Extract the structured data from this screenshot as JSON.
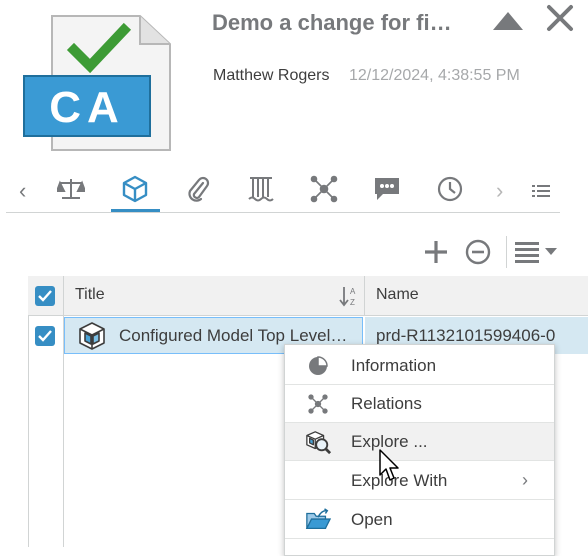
{
  "header": {
    "title": "Demo a change for fi…",
    "author": "Matthew Rogers",
    "date": "12/12/2024, 4:38:55 PM",
    "app_icon_text": "CA"
  },
  "tabs": [
    {
      "name": "scales-icon",
      "active": false
    },
    {
      "name": "cube-icon",
      "active": true
    },
    {
      "name": "paperclip-icon",
      "active": false
    },
    {
      "name": "columns-icon",
      "active": false
    },
    {
      "name": "relations-icon",
      "active": false
    },
    {
      "name": "chat-icon",
      "active": false
    },
    {
      "name": "clock-icon",
      "active": false
    }
  ],
  "tab_nav": {
    "prev": "‹",
    "next": "›"
  },
  "toolbar": {
    "icons": [
      "plus-icon",
      "minus-circle-icon",
      "list-view-icon"
    ]
  },
  "table": {
    "columns": [
      "Title",
      "Name"
    ],
    "rows": [
      {
        "title": "Configured Model Top Level…",
        "name": "prd-R1132101599406-0",
        "selected": true
      }
    ]
  },
  "context_menu": {
    "items": [
      {
        "label": "Information",
        "icon": "info-icon"
      },
      {
        "label": "Relations",
        "icon": "relations-icon"
      },
      {
        "label": "Explore ...",
        "icon": "explore-icon",
        "hover": true
      },
      {
        "label": "Explore With",
        "icon": "",
        "submenu": "›"
      },
      {
        "label": "Open",
        "icon": "open-icon"
      }
    ]
  },
  "colors": {
    "accent": "#368ec4",
    "selection": "#d5e8f2",
    "text": "#3d3d3d",
    "muted": "#77797c"
  }
}
